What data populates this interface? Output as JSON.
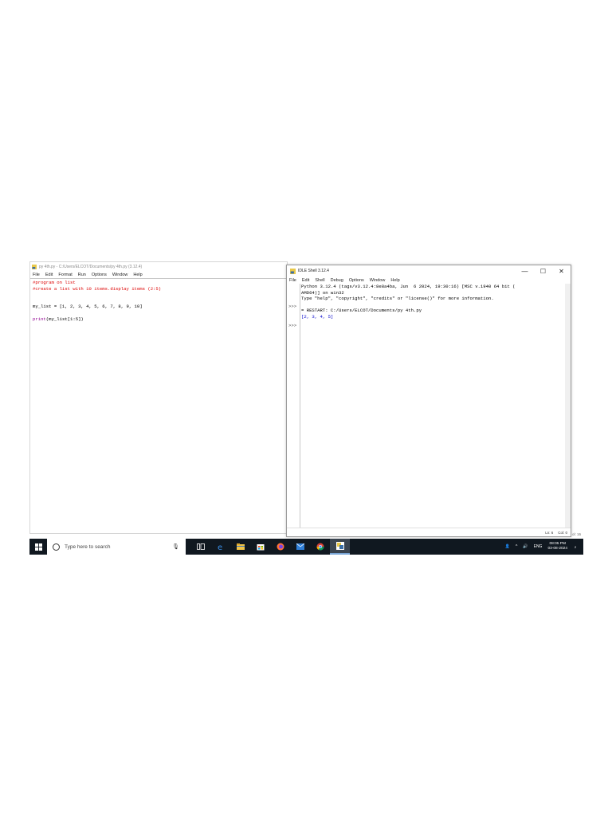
{
  "editor": {
    "title": "py 4th.py - C:/Users/ELCOT/Documents/py 4th.py (3.12.4)",
    "menu": [
      "File",
      "Edit",
      "Format",
      "Run",
      "Options",
      "Window",
      "Help"
    ],
    "code": {
      "line1": "#program on list",
      "line2": "#create a list with 10 items.display items (2:5)",
      "line3": "my_list = [1, 2, 3, 4, 5, 6, 7, 8, 9, 10]",
      "line4_builtin": "print",
      "line4_rest": "(my_list[1:5])"
    }
  },
  "shell": {
    "title": "IDLE Shell 3.12.4",
    "controls": {
      "minimize": "—",
      "maximize": "☐",
      "close": "✕"
    },
    "menu": [
      "File",
      "Edit",
      "Shell",
      "Debug",
      "Options",
      "Window",
      "Help"
    ],
    "output": {
      "banner1": "Python 3.12.4 (tags/v3.12.4:8e8a4ba, Jun  6 2024, 19:30:16) [MSC v.1940 64 bit (",
      "banner2": "AMD64)] on win32",
      "banner3": "Type \"help\", \"copyright\", \"credits\" or \"license()\" for more information.",
      "restart": "= RESTART: C:/Users/ELCOT/Documents/py 4th.py",
      "result": "[2, 3, 4, 5]"
    },
    "prompt": ">>>",
    "status": {
      "line": "Ln: 6",
      "col": "Col: 0"
    },
    "edge_text": "ol: 16"
  },
  "taskbar": {
    "search_placeholder": "Type here to search",
    "tray": {
      "lang": "ENG",
      "time": "08:05 PM",
      "date": "03-08-2024",
      "notif_count": "2"
    }
  },
  "colors": {
    "comment": "#dd0000",
    "builtin": "#900090",
    "stdout": "#0000cc",
    "taskbar": "#101820"
  }
}
